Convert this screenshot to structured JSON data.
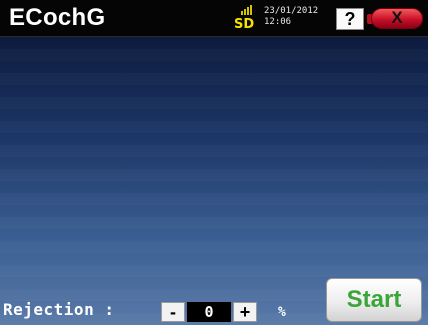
{
  "app": {
    "title": "ECochG"
  },
  "status_bar": {
    "storage_label": "SD",
    "storage_icon": "sd-card-signal-icon",
    "date": "23/01/2012",
    "time": "12:06",
    "help_label": "?",
    "help_icon": "question-mark-icon",
    "close_label": "X",
    "close_icon": "close-icon"
  },
  "controls": {
    "rejection_label": "Rejection :",
    "minus_label": "-",
    "rejection_value": "0",
    "plus_label": "+",
    "unit": "%",
    "start_label": "Start"
  },
  "colors": {
    "title_bar": "#050505",
    "background_top": "#0c1b3e",
    "background_bottom": "#5879a8",
    "close_button": "#c8102a",
    "sd_text": "#f4e200",
    "start_text": "#3aa63a"
  }
}
